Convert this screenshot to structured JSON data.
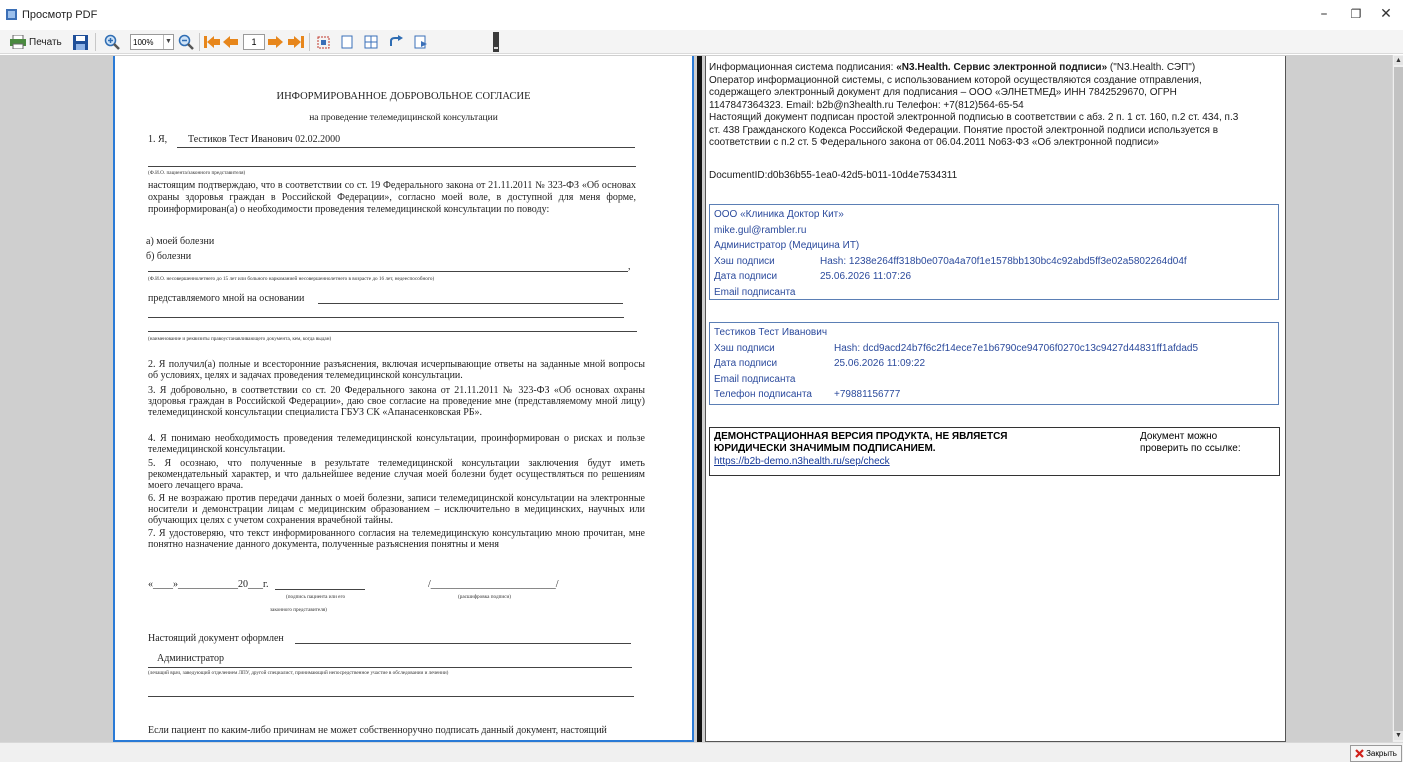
{
  "window": {
    "title": "Просмотр PDF",
    "minimize_glyph": "–",
    "restore_glyph": "❐",
    "close_glyph": "✕"
  },
  "toolbar": {
    "print_label": "Печать",
    "zoom_value": "100%",
    "page_value": "1",
    "icons": [
      "printer-icon",
      "save-icon",
      "zoom-in-icon",
      "zoom-out-icon",
      "first-page-icon",
      "prev-page-icon",
      "next-page-icon",
      "last-page-icon",
      "fit-page-icon",
      "single-page-icon",
      "two-page-icon",
      "rotate-icon",
      "export-icon"
    ]
  },
  "left_page": {
    "title": "ИНФОРМИРОВАННОЕ ДОБРОВОЛЬНОЕ СОГЛАСИЕ",
    "subtitle": "на проведение телемедицинской консультации",
    "item1_prefix": "1.  Я,",
    "patient": "Тестиков Тест Иванович  02.02.2000",
    "fio_hint": "(Ф.И.О. пациента/законного представителя)",
    "para1": "настоящим подтверждаю, что в соответствии со ст. 19 Федерального закона от 21.11.2011 № 323-ФЗ «Об основах охраны здоровья граждан в Российской Федерации», согласно моей воле, в доступной для меня форме, проинформирован(а) о необходимости проведения телемедицинской консультации по поводу:",
    "opt_a": "а) моей болезни",
    "opt_b": "б) болезни",
    "opt_b_end": ",",
    "minor_hint": "(Ф.И.О. несовершеннолетнего до 15 лет или больного наркоманией несовершеннолетнего в возрасте до 16 лет, недееспособного)",
    "represented": "представляемого мной на основании",
    "doc_hint": "(наименование и реквизиты правоустанавливающего документа, кем, когда выдан)",
    "p2": "2.  Я получил(а) полные и всесторонние разъяснения, включая исчерпывающие ответы на заданные мной вопросы об условиях, целях и задачах проведения телемедицинской консультации.",
    "p3": "3.  Я добровольно, в соответствии со ст. 20 Федерального закона от 21.11.2011 № 323-ФЗ «Об основах охраны здоровья граждан в Российской Федерации», даю свое согласие на проведение мне (представляемому мной лицу) телемедицинской консультации специалиста ГБУЗ СК «Апанасенковская РБ».",
    "p4": "4.  Я понимаю необходимость проведения телемедицинской консультации, проинформирован о рисках и пользе телемедицинской консультации.",
    "p5": "5.  Я осознаю, что полученные в результате телемедицинской консультации заключения будут иметь рекомендательный характер, и что дальнейшее ведение случая моей болезни будет осуществляться по решениям моего лечащего врача.",
    "p6": "6.  Я не возражаю против передачи данных о моей болезни, записи телемедицинской консультации на электронные носители и демонстрации лицам с медицинским образованием – исключительно в медицинских, научных или обучающих целях с учетом сохранения врачебной тайны.",
    "p7": "7.  Я удостоверяю, что текст информированного согласия на телемедицинскую консультацию мною прочитан, мне понятно назначение данного документа, полученные разъяснения понятны и меня",
    "date_line": "«____»____________20___г.",
    "slash_line": "/_________________________/",
    "sign_hint1": "(подпись пациента или его",
    "sign_hint2": "законного представителя)",
    "decode_hint": "(расшифровка подписи)",
    "issued": "Настоящий документ оформлен",
    "admin": "Администратор",
    "doctor_hint": "(лечащий врач, заведующий отделением ЛПУ, другой специалист, принимающий непосредственное участие в обследовании и лечении)",
    "last_para": "Если пациент по каким-либо причинам не может собственноручно подписать данный документ, настоящий"
  },
  "right_page": {
    "info_label": "Информационная система подписания: ",
    "info_bold": "«N3.Health. Сервис электронной подписи»",
    "info_tail": " (\"N3.Health. СЭП\")",
    "info_lines": [
      "Оператор информационной системы, с использованием которой осуществляются создание отправления,",
      "содержащего электронный документ для подписания – ООО «ЭЛНЕТМЕД» ИНН 7842529670, ОГРН",
      "1147847364323. Email: b2b@n3health.ru Телефон: +7(812)564-65-54",
      "Настоящий документ подписан простой электронной подписью в соответствии с абз. 2 п. 1 ст. 160, п.2 ст. 434, п.3",
      "ст. 438 Гражданского Кодекса Российской Федерации. Понятие простой электронной подписи используется в",
      "соответствии с п.2 ст. 5 Федерального закона от 06.04.2011 No63-ФЗ «Об электронной подписи»"
    ],
    "document_id": "DocumentID:d0b36b55-1ea0-42d5-b011-10d4e7534311",
    "sig1": {
      "org": "ООО «Клиника Доктор Кит»",
      "email": "mike.gul@rambler.ru",
      "role": "Администратор (Медицина ИТ)",
      "hash_label": "Хэш подписи",
      "hash_value": "Hash: 1238e264ff318b0e070a4a70f1e1578bb130bc4c92abd5ff3e02a5802264d04f",
      "date_label": "Дата подписи",
      "date_value": "25.06.2026 11:07:26",
      "email_label": "Email подписанта"
    },
    "sig2": {
      "name": "Тестиков Тест Иванович",
      "hash_label": "Хэш подписи",
      "hash_value": "Hash: dcd9acd24b7f6c2f14ece7e1b6790ce94706f0270c13c9427d44831ff1afdad5",
      "date_label": "Дата подписи",
      "date_value": "25.06.2026 11:09:22",
      "email_label": "Email подписанта",
      "phone_label": "Телефон подписанта",
      "phone_value": "+79881156777"
    },
    "demo": {
      "line1": "ДЕМОНСТРАЦИОННАЯ ВЕРСИЯ ПРОДУКТА, НЕ ЯВЛЯЕТСЯ",
      "line2": "ЮРИДИЧЕСКИ ЗНАЧИМЫМ ПОДПИСАНИЕМ.",
      "link": "https://b2b-demo.n3health.ru/sep/check",
      "check1": "Документ можно",
      "check2": "проверить по ссылке:"
    }
  },
  "statusbar": {
    "close_label": "Закрыть"
  }
}
